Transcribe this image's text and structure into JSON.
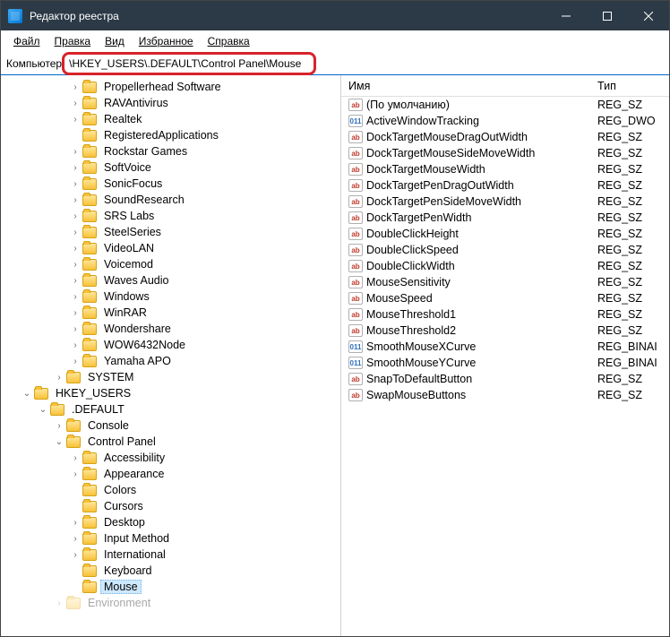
{
  "title": "Редактор реестра",
  "menus": [
    "Файл",
    "Правка",
    "Вид",
    "Избранное",
    "Справка"
  ],
  "address_label": "Компьютер",
  "address_path": "\\HKEY_USERS\\.DEFAULT\\Control Panel\\Mouse",
  "tree_top": [
    {
      "l": "Propellerhead Software",
      "d": 4,
      "e": ">"
    },
    {
      "l": "RAVAntivirus",
      "d": 4,
      "e": ">"
    },
    {
      "l": "Realtek",
      "d": 4,
      "e": ">"
    },
    {
      "l": "RegisteredApplications",
      "d": 4,
      "e": ""
    },
    {
      "l": "Rockstar Games",
      "d": 4,
      "e": ">"
    },
    {
      "l": "SoftVoice",
      "d": 4,
      "e": ">"
    },
    {
      "l": "SonicFocus",
      "d": 4,
      "e": ">"
    },
    {
      "l": "SoundResearch",
      "d": 4,
      "e": ">"
    },
    {
      "l": "SRS Labs",
      "d": 4,
      "e": ">"
    },
    {
      "l": "SteelSeries",
      "d": 4,
      "e": ">"
    },
    {
      "l": "VideoLAN",
      "d": 4,
      "e": ">"
    },
    {
      "l": "Voicemod",
      "d": 4,
      "e": ">"
    },
    {
      "l": "Waves Audio",
      "d": 4,
      "e": ">"
    },
    {
      "l": "Windows",
      "d": 4,
      "e": ">"
    },
    {
      "l": "WinRAR",
      "d": 4,
      "e": ">"
    },
    {
      "l": "Wondershare",
      "d": 4,
      "e": ">"
    },
    {
      "l": "WOW6432Node",
      "d": 4,
      "e": ">"
    },
    {
      "l": "Yamaha APO",
      "d": 4,
      "e": ">"
    },
    {
      "l": "SYSTEM",
      "d": 3,
      "e": ">"
    },
    {
      "l": "HKEY_USERS",
      "d": 1,
      "e": "v"
    },
    {
      "l": ".DEFAULT",
      "d": 2,
      "e": "v"
    },
    {
      "l": "Console",
      "d": 3,
      "e": ">"
    },
    {
      "l": "Control Panel",
      "d": 3,
      "e": "v"
    },
    {
      "l": "Accessibility",
      "d": 4,
      "e": ">"
    },
    {
      "l": "Appearance",
      "d": 4,
      "e": ">"
    },
    {
      "l": "Colors",
      "d": 4,
      "e": ""
    },
    {
      "l": "Cursors",
      "d": 4,
      "e": ""
    },
    {
      "l": "Desktop",
      "d": 4,
      "e": ">"
    },
    {
      "l": "Input Method",
      "d": 4,
      "e": ">"
    },
    {
      "l": "International",
      "d": 4,
      "e": ">"
    },
    {
      "l": "Keyboard",
      "d": 4,
      "e": ""
    },
    {
      "l": "Mouse",
      "d": 4,
      "e": "",
      "sel": true
    },
    {
      "l": "Environment",
      "d": 3,
      "e": ">",
      "fade": true
    }
  ],
  "list_headers": {
    "name": "Имя",
    "type": "Тип"
  },
  "values": [
    {
      "n": "(По умолчанию)",
      "t": "REG_SZ",
      "k": "s"
    },
    {
      "n": "ActiveWindowTracking",
      "t": "REG_DWO",
      "k": "b"
    },
    {
      "n": "DockTargetMouseDragOutWidth",
      "t": "REG_SZ",
      "k": "s"
    },
    {
      "n": "DockTargetMouseSideMoveWidth",
      "t": "REG_SZ",
      "k": "s"
    },
    {
      "n": "DockTargetMouseWidth",
      "t": "REG_SZ",
      "k": "s"
    },
    {
      "n": "DockTargetPenDragOutWidth",
      "t": "REG_SZ",
      "k": "s"
    },
    {
      "n": "DockTargetPenSideMoveWidth",
      "t": "REG_SZ",
      "k": "s"
    },
    {
      "n": "DockTargetPenWidth",
      "t": "REG_SZ",
      "k": "s"
    },
    {
      "n": "DoubleClickHeight",
      "t": "REG_SZ",
      "k": "s"
    },
    {
      "n": "DoubleClickSpeed",
      "t": "REG_SZ",
      "k": "s"
    },
    {
      "n": "DoubleClickWidth",
      "t": "REG_SZ",
      "k": "s"
    },
    {
      "n": "MouseSensitivity",
      "t": "REG_SZ",
      "k": "s"
    },
    {
      "n": "MouseSpeed",
      "t": "REG_SZ",
      "k": "s"
    },
    {
      "n": "MouseThreshold1",
      "t": "REG_SZ",
      "k": "s"
    },
    {
      "n": "MouseThreshold2",
      "t": "REG_SZ",
      "k": "s"
    },
    {
      "n": "SmoothMouseXCurve",
      "t": "REG_BINAI",
      "k": "b"
    },
    {
      "n": "SmoothMouseYCurve",
      "t": "REG_BINAI",
      "k": "b"
    },
    {
      "n": "SnapToDefaultButton",
      "t": "REG_SZ",
      "k": "s"
    },
    {
      "n": "SwapMouseButtons",
      "t": "REG_SZ",
      "k": "s"
    }
  ]
}
